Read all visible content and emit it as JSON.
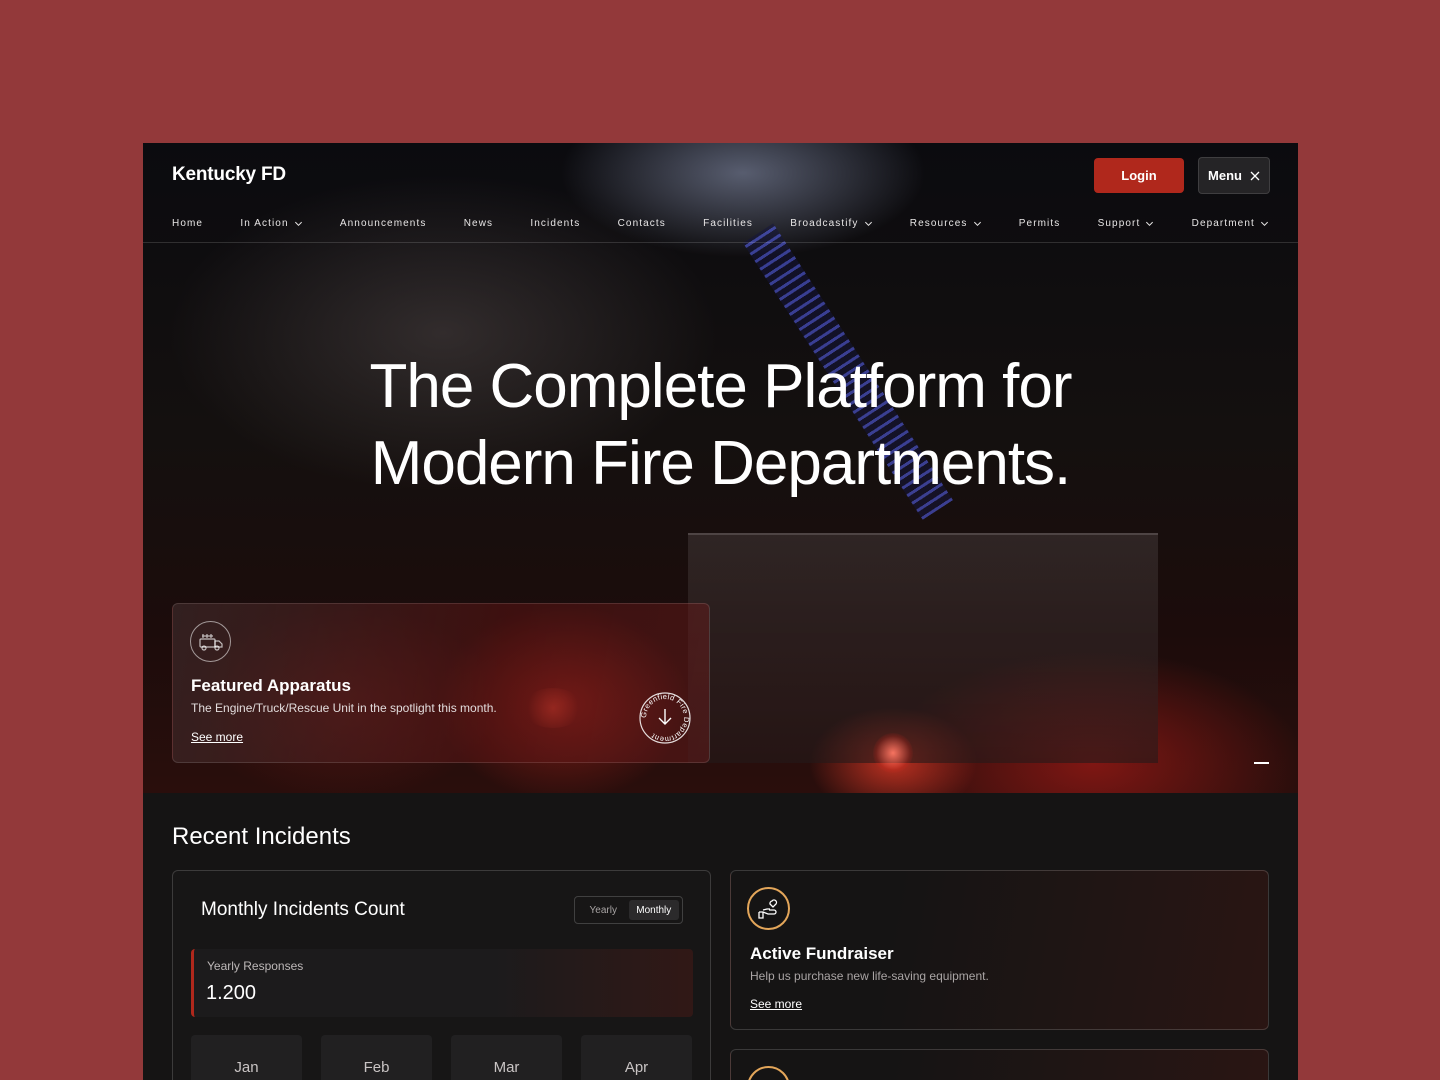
{
  "brand": "Kentucky FD",
  "header": {
    "login_label": "Login",
    "menu_label": "Menu"
  },
  "nav": [
    {
      "label": "Home",
      "dropdown": false
    },
    {
      "label": "In Action",
      "dropdown": true
    },
    {
      "label": "Announcements",
      "dropdown": false
    },
    {
      "label": "News",
      "dropdown": false
    },
    {
      "label": "Incidents",
      "dropdown": false
    },
    {
      "label": "Contacts",
      "dropdown": false
    },
    {
      "label": "Facilities",
      "dropdown": false
    },
    {
      "label": "Broadcastify",
      "dropdown": true
    },
    {
      "label": "Resources",
      "dropdown": true
    },
    {
      "label": "Permits",
      "dropdown": false
    },
    {
      "label": "Support",
      "dropdown": true
    },
    {
      "label": "Department",
      "dropdown": true
    }
  ],
  "hero": {
    "title_line1": "The Complete Platform for",
    "title_line2": "Modern Fire Departments."
  },
  "featured": {
    "icon": "fire-truck-icon",
    "title": "Featured Apparatus",
    "description": "The Engine/Truck/Rescue Unit in the spotlight this month.",
    "link": "See more",
    "seal_text": "Greenfield Fire Department"
  },
  "recent": {
    "section_title": "Recent Incidents",
    "card_title": "Monthly Incidents Count",
    "toggle": {
      "yearly": "Yearly",
      "monthly": "Monthly",
      "active": "monthly"
    },
    "stat_label": "Yearly Responses",
    "stat_value": "1.200",
    "months": [
      "Jan",
      "Feb",
      "Mar",
      "Apr"
    ]
  },
  "fundraiser": {
    "icon": "donation-hand-icon",
    "title": "Active Fundraiser",
    "description": "Help us purchase new life-saving equipment.",
    "link": "See more"
  },
  "colors": {
    "background": "#93393a",
    "accent": "#b0281c",
    "gold": "#e3a65a"
  }
}
